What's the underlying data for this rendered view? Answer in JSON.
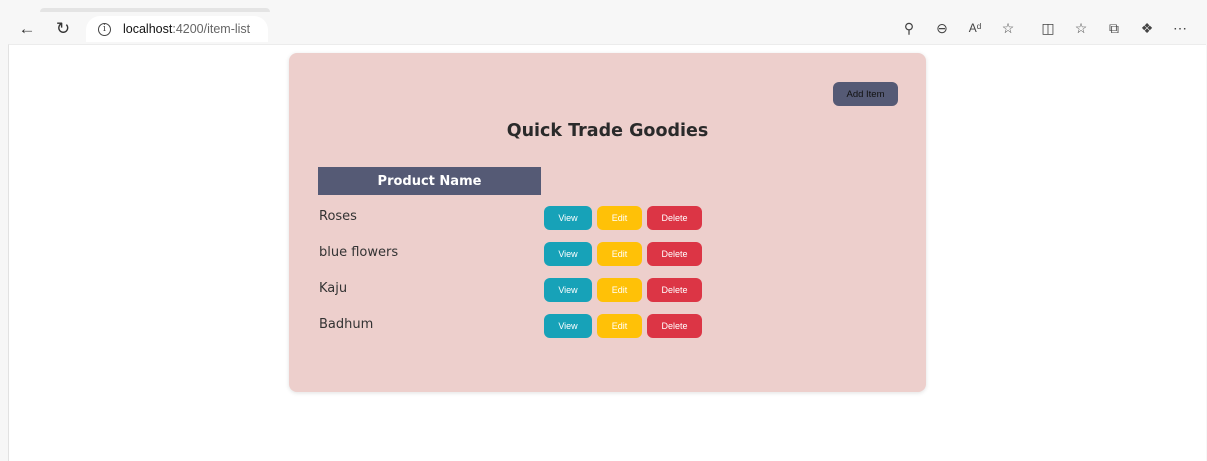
{
  "browser": {
    "url_host": "localhost",
    "url_path": ":4200/item-list",
    "icons": [
      "back-icon",
      "refresh-icon",
      "info-icon",
      "key-icon",
      "zoom-out-icon",
      "read-aloud-icon",
      "favorite-star-icon",
      "split-screen-icon",
      "favorites-list-icon",
      "collections-icon",
      "extensions-icon",
      "more-icon"
    ]
  },
  "page": {
    "add_button_label": "Add Item",
    "title": "Quick Trade Goodies",
    "column_header": "Product Name",
    "items": [
      {
        "name": "Roses",
        "view": "View",
        "edit": "Edit",
        "delete": "Delete"
      },
      {
        "name": "blue flowers",
        "view": "View",
        "edit": "Edit",
        "delete": "Delete"
      },
      {
        "name": "Kaju",
        "view": "View",
        "edit": "Edit",
        "delete": "Delete"
      },
      {
        "name": "Badhum",
        "view": "View",
        "edit": "Edit",
        "delete": "Delete"
      }
    ]
  },
  "colors": {
    "card_background": "#edcfcc",
    "header_background": "#555a75",
    "view_button": "#17a2b8",
    "edit_button": "#ffc107",
    "delete_button": "#dc3545"
  }
}
